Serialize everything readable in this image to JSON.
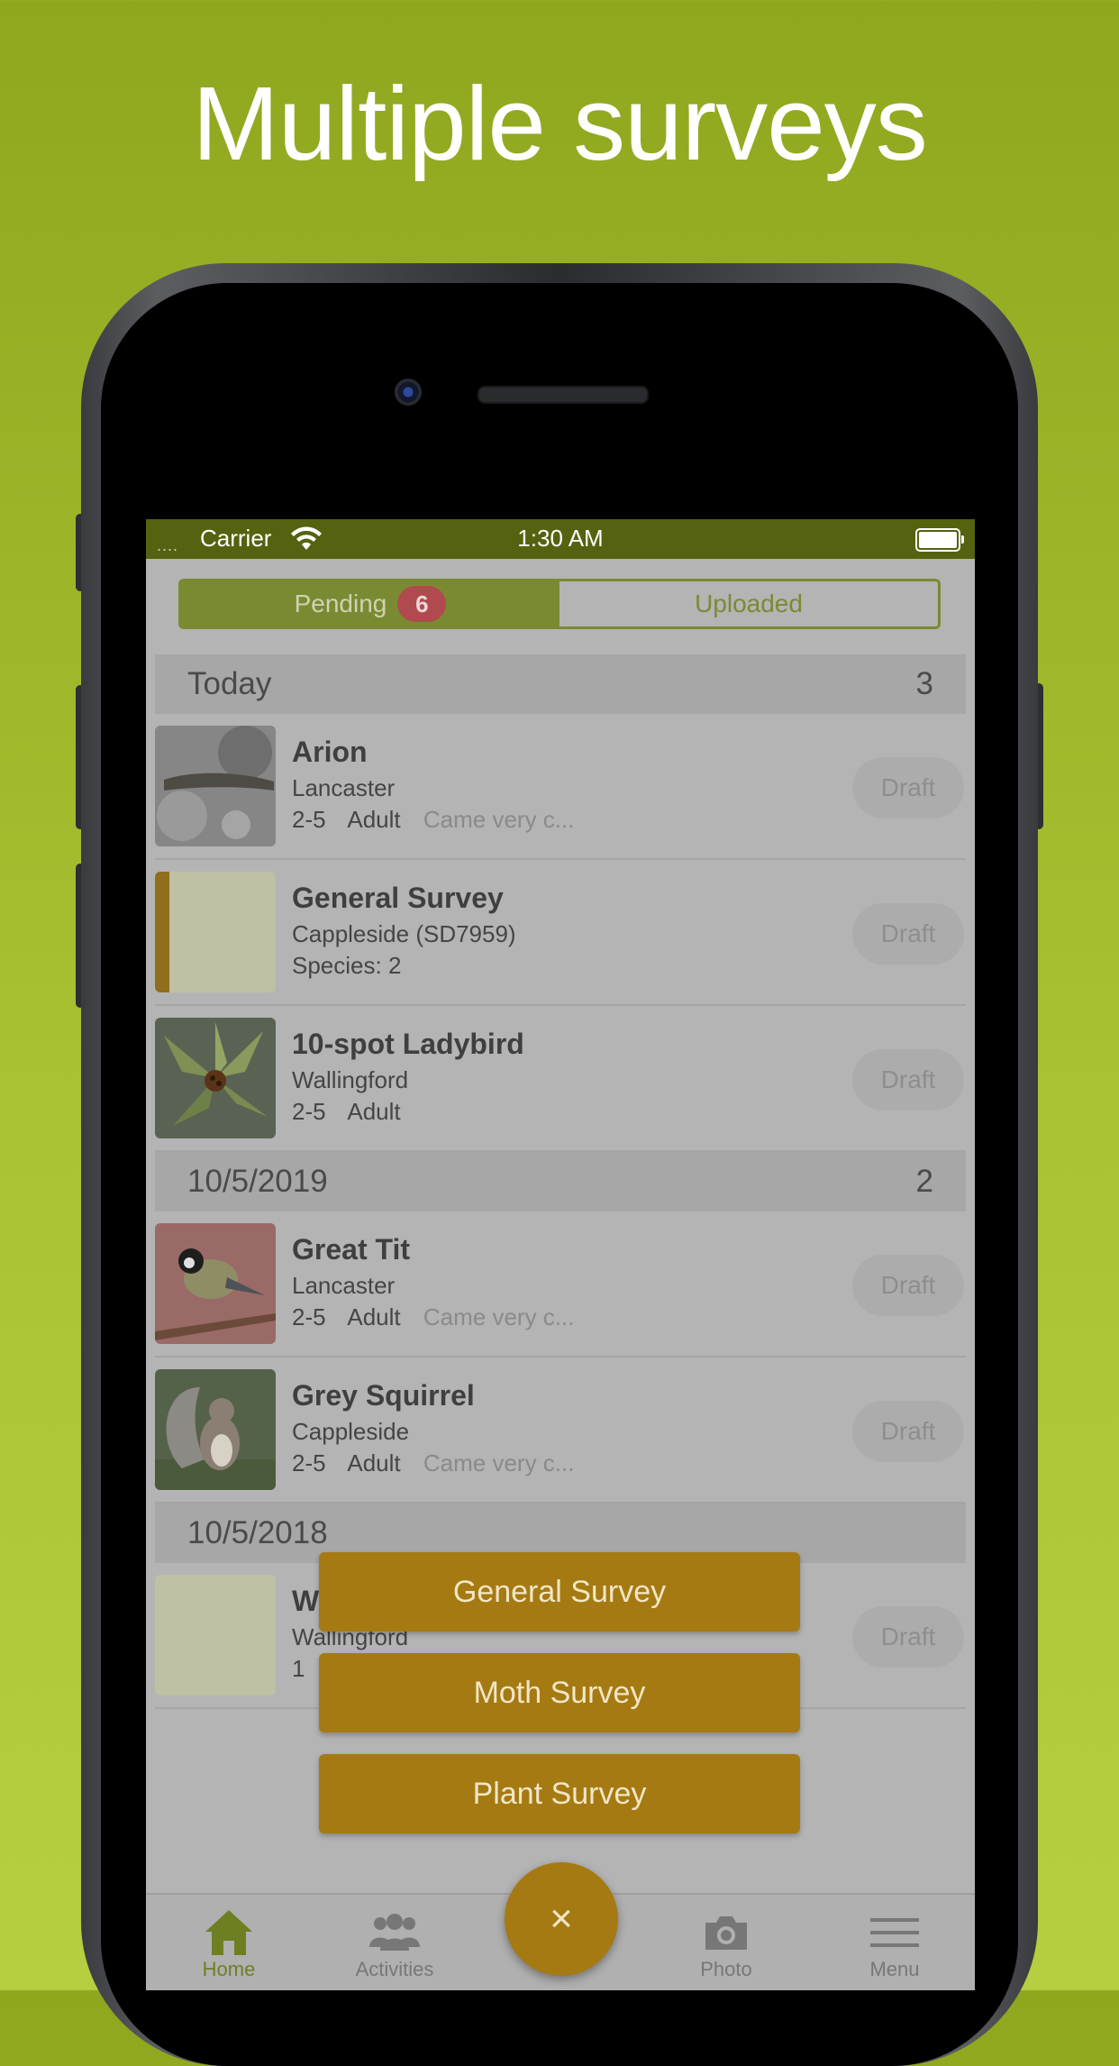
{
  "headline": "Multiple surveys",
  "status_bar": {
    "signal": "....",
    "carrier": "Carrier",
    "time": "1:30 AM"
  },
  "segment": {
    "pending_label": "Pending",
    "pending_count": "6",
    "uploaded_label": "Uploaded"
  },
  "sections": [
    {
      "date": "Today",
      "count": "3",
      "records": [
        {
          "title": "Arion",
          "location": "Lancaster",
          "count": "2-5",
          "stage": "Adult",
          "note": "Came very c...",
          "status": "Draft",
          "thumb": "slug-photo"
        },
        {
          "title": "General Survey",
          "location": "Cappleside (SD7959)",
          "species": "Species: 2",
          "status": "Draft",
          "thumb": "survey-placeholder"
        },
        {
          "title": "10-spot Ladybird",
          "location": "Wallingford",
          "count": "2-5",
          "stage": "Adult",
          "status": "Draft",
          "thumb": "ladybird-photo"
        }
      ]
    },
    {
      "date": "10/5/2019",
      "count": "2",
      "records": [
        {
          "title": "Great Tit",
          "location": "Lancaster",
          "count": "2-5",
          "stage": "Adult",
          "note": "Came very c...",
          "status": "Draft",
          "thumb": "bird-photo"
        },
        {
          "title": "Grey Squirrel",
          "location": "Cappleside",
          "count": "2-5",
          "stage": "Adult",
          "note": "Came very c...",
          "status": "Draft",
          "thumb": "squirrel-photo"
        }
      ]
    },
    {
      "date": "10/5/2018",
      "count": "",
      "records": [
        {
          "title": "W",
          "location": "Wallingford",
          "count": "1",
          "status": "Draft",
          "thumb": "blank-placeholder"
        }
      ]
    }
  ],
  "survey_menu": [
    "General Survey",
    "Moth Survey",
    "Plant Survey"
  ],
  "fab_label": "×",
  "tabs": [
    {
      "label": "Home",
      "icon": "home-icon",
      "active": true
    },
    {
      "label": "Activities",
      "icon": "people-icon",
      "active": false
    },
    {
      "label": "Photo",
      "icon": "camera-icon",
      "active": false
    },
    {
      "label": "Menu",
      "icon": "menu-icon",
      "active": false
    }
  ],
  "colors": {
    "background": "#a8c233",
    "status_bar": "#55620f",
    "accent_green": "#7a8a33",
    "survey_button": "#a57a12",
    "badge": "#b04a4e"
  }
}
